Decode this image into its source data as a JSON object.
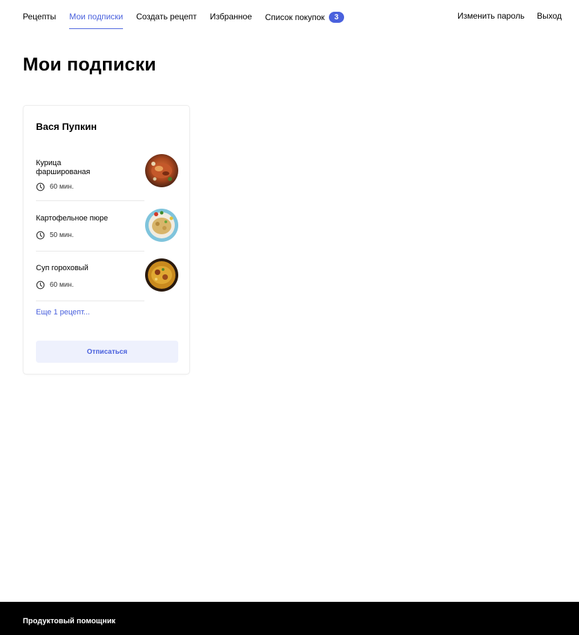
{
  "nav": {
    "items": [
      {
        "label": "Рецепты"
      },
      {
        "label": "Мои подписки"
      },
      {
        "label": "Создать рецепт"
      },
      {
        "label": "Избранное"
      },
      {
        "label": "Список покупок",
        "badge": "3"
      }
    ],
    "right": [
      {
        "label": "Изменить пароль"
      },
      {
        "label": "Выход"
      }
    ]
  },
  "page": {
    "title": "Мои подписки"
  },
  "subscription": {
    "author": "Вася Пупкин",
    "recipes": [
      {
        "name": "Курица фаршированая",
        "time": "60 мин."
      },
      {
        "name": "Картофельное пюре",
        "time": "50 мин."
      },
      {
        "name": "Суп гороховый",
        "time": "60 мин."
      }
    ],
    "more_link": "Еще 1 рецепт...",
    "unsubscribe_label": "Отписаться"
  },
  "footer": {
    "brand": "Продуктовый помощник"
  },
  "colors": {
    "accent": "#4a61dd",
    "button_bg": "#eef1fd",
    "footer_bg": "#000000"
  }
}
